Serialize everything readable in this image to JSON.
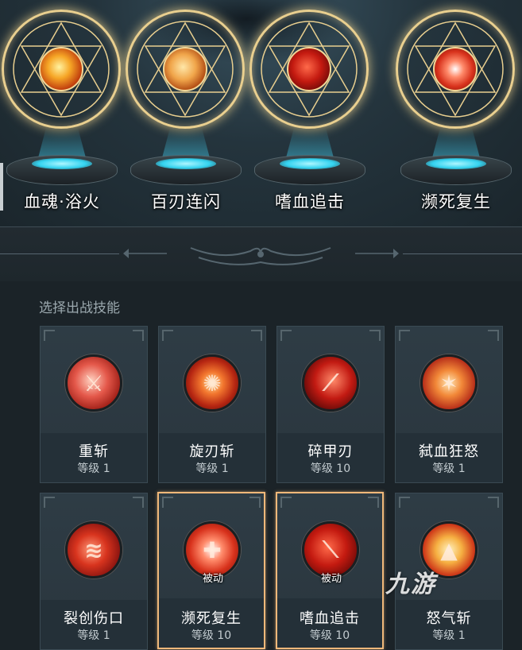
{
  "equipped_skills": [
    {
      "name": "血魂·浴火",
      "icon": "flame-burst-icon"
    },
    {
      "name": "百刃连闪",
      "icon": "crossed-blades-icon"
    },
    {
      "name": "嗜血追击",
      "icon": "blood-slash-icon"
    },
    {
      "name": "濒死复生",
      "icon": "revive-cross-icon"
    }
  ],
  "selection": {
    "title": "选择出战技能",
    "level_prefix": "等级",
    "cards": [
      {
        "name": "重斩",
        "level": "等级 1",
        "icon": "axe-slash-icon",
        "passive": "",
        "selected": false
      },
      {
        "name": "旋刃斩",
        "level": "等级 1",
        "icon": "spinning-blade-icon",
        "passive": "",
        "selected": false
      },
      {
        "name": "碎甲刃",
        "level": "等级 10",
        "icon": "armor-pierce-icon",
        "passive": "",
        "selected": false
      },
      {
        "name": "弑血狂怒",
        "level": "等级 1",
        "icon": "blood-frenzy-icon",
        "passive": "",
        "selected": false
      },
      {
        "name": "裂创伤口",
        "level": "等级 1",
        "icon": "claw-wound-icon",
        "passive": "",
        "selected": false
      },
      {
        "name": "濒死复生",
        "level": "等级 10",
        "icon": "revive-cross-icon",
        "passive": "被动",
        "selected": true
      },
      {
        "name": "嗜血追击",
        "level": "等级 10",
        "icon": "blood-slash-icon",
        "passive": "被动",
        "selected": true
      },
      {
        "name": "怒气斩",
        "level": "等级 1",
        "icon": "rage-blade-icon",
        "passive": "",
        "selected": false
      }
    ]
  },
  "watermark": "九游",
  "colors": {
    "selected_border": "#f0b87a",
    "seal_gold": "#e9cf8f",
    "pedestal_glow": "#34d3f0"
  }
}
